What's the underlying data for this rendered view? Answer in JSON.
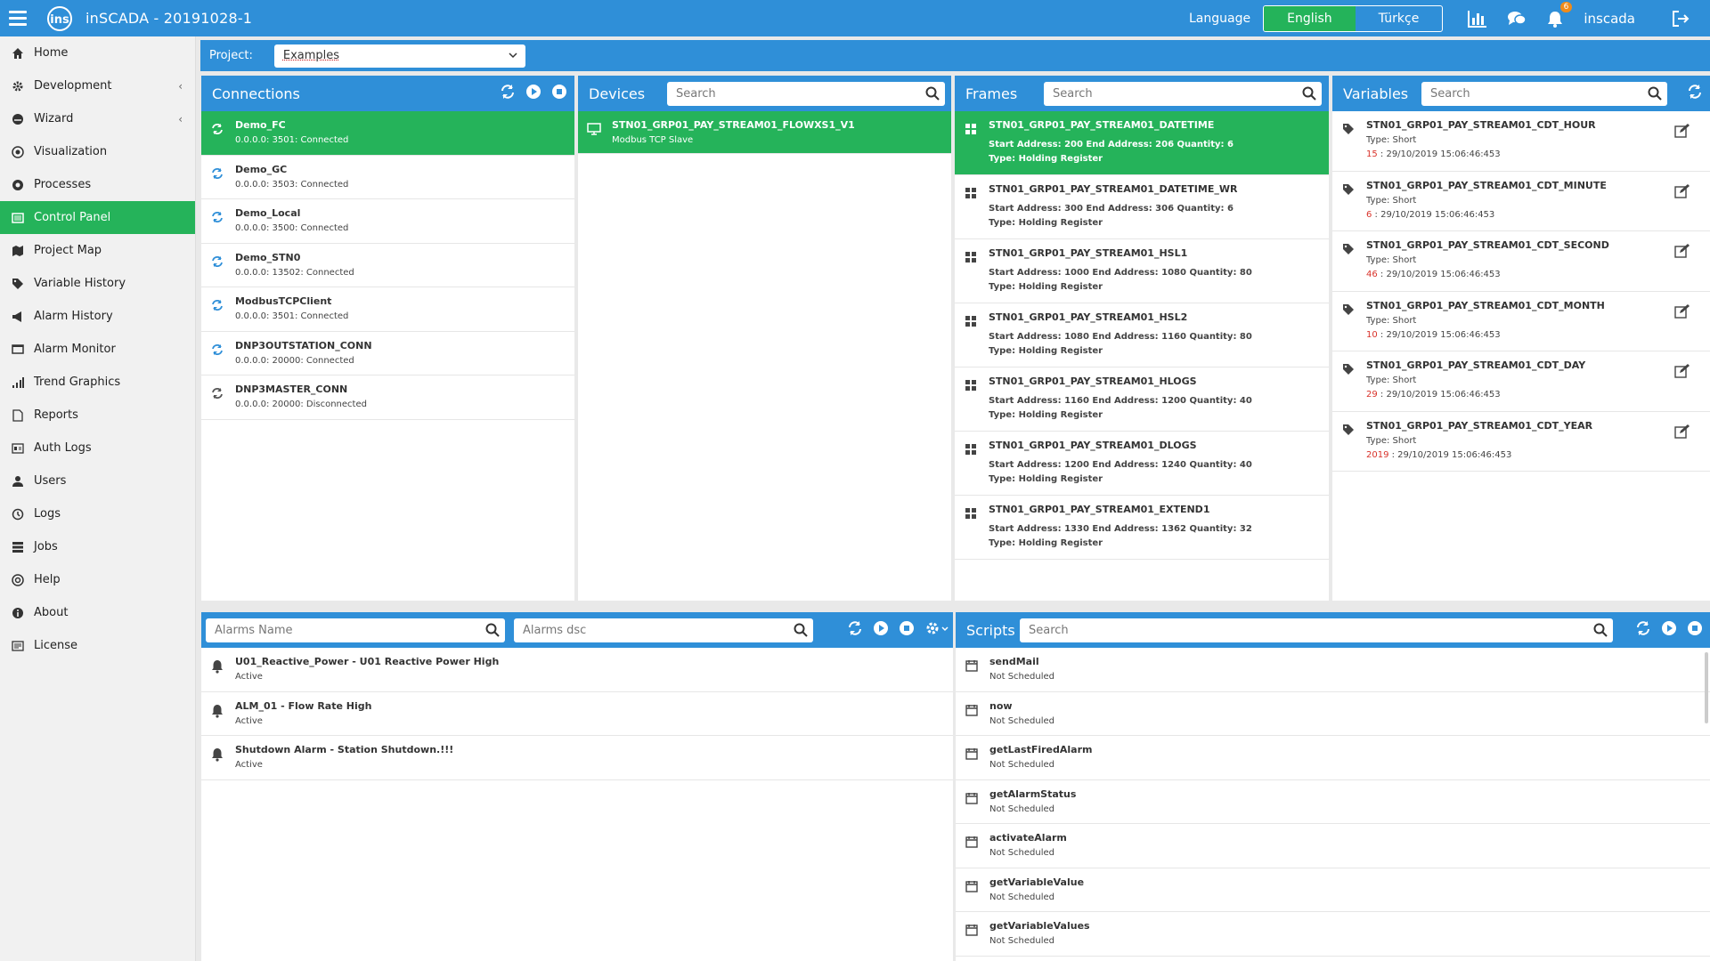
{
  "app": {
    "title": "inSCADA - 20191028-1"
  },
  "header": {
    "language_label": "Language",
    "languages": [
      {
        "label": "English",
        "active": true
      },
      {
        "label": "Türkçe",
        "active": false
      }
    ],
    "notification_count": "6",
    "username": "inscada"
  },
  "sidebar": {
    "items": [
      {
        "label": "Home",
        "icon": "home-icon",
        "active": false,
        "submenu": false
      },
      {
        "label": "Development",
        "icon": "gear-icon",
        "active": false,
        "submenu": true
      },
      {
        "label": "Wizard",
        "icon": "wizard-icon",
        "active": false,
        "submenu": true
      },
      {
        "label": "Visualization",
        "icon": "eye-icon",
        "active": false,
        "submenu": false
      },
      {
        "label": "Processes",
        "icon": "cog-circle-icon",
        "active": false,
        "submenu": false
      },
      {
        "label": "Control Panel",
        "icon": "control-panel-icon",
        "active": true,
        "submenu": false
      },
      {
        "label": "Project Map",
        "icon": "map-icon",
        "active": false,
        "submenu": false
      },
      {
        "label": "Variable History",
        "icon": "tag-icon",
        "active": false,
        "submenu": false
      },
      {
        "label": "Alarm History",
        "icon": "megaphone-icon",
        "active": false,
        "submenu": false
      },
      {
        "label": "Alarm Monitor",
        "icon": "monitor-icon",
        "active": false,
        "submenu": false
      },
      {
        "label": "Trend Graphics",
        "icon": "signal-icon",
        "active": false,
        "submenu": false
      },
      {
        "label": "Reports",
        "icon": "report-icon",
        "active": false,
        "submenu": false
      },
      {
        "label": "Auth Logs",
        "icon": "id-card-icon",
        "active": false,
        "submenu": false
      },
      {
        "label": "Users",
        "icon": "user-icon",
        "active": false,
        "submenu": false
      },
      {
        "label": "Logs",
        "icon": "history-icon",
        "active": false,
        "submenu": false
      },
      {
        "label": "Jobs",
        "icon": "server-icon",
        "active": false,
        "submenu": false
      },
      {
        "label": "Help",
        "icon": "help-icon",
        "active": false,
        "submenu": false
      },
      {
        "label": "About",
        "icon": "info-icon",
        "active": false,
        "submenu": false
      },
      {
        "label": "License",
        "icon": "license-icon",
        "active": false,
        "submenu": false
      }
    ]
  },
  "project": {
    "label": "Project:",
    "value": "Examples"
  },
  "connections": {
    "title": "Connections",
    "items": [
      {
        "name": "Demo_FC",
        "detail": "0.0.0.0: 3501: Connected",
        "selected": true
      },
      {
        "name": "Demo_GC",
        "detail": "0.0.0.0: 3503: Connected",
        "selected": false
      },
      {
        "name": "Demo_Local",
        "detail": "0.0.0.0: 3500: Connected",
        "selected": false
      },
      {
        "name": "Demo_STN0",
        "detail": "0.0.0.0: 13502: Connected",
        "selected": false
      },
      {
        "name": "ModbusTCPClient",
        "detail": "0.0.0.0: 3501: Connected",
        "selected": false
      },
      {
        "name": "DNP3OUTSTATION_CONN",
        "detail": "0.0.0.0: 20000: Connected",
        "selected": false
      },
      {
        "name": "DNP3MASTER_CONN",
        "detail": "0.0.0.0: 20000: Disconnected",
        "selected": false
      }
    ]
  },
  "devices": {
    "title": "Devices",
    "search_placeholder": "Search",
    "items": [
      {
        "name": "STN01_GRP01_PAY_STREAM01_FLOWXS1_V1",
        "detail": "Modbus TCP Slave",
        "selected": true
      }
    ]
  },
  "frames": {
    "title": "Frames",
    "search_placeholder": "Search",
    "items": [
      {
        "name": "STN01_GRP01_PAY_STREAM01_DATETIME",
        "address": "Start Address: 200 End Address: 206 Quantity: 6",
        "type": "Type: Holding Register",
        "selected": true
      },
      {
        "name": "STN01_GRP01_PAY_STREAM01_DATETIME_WR",
        "address": "Start Address: 300 End Address: 306 Quantity: 6",
        "type": "Type: Holding Register",
        "selected": false
      },
      {
        "name": "STN01_GRP01_PAY_STREAM01_HSL1",
        "address": "Start Address: 1000 End Address: 1080 Quantity: 80",
        "type": "Type: Holding Register",
        "selected": false
      },
      {
        "name": "STN01_GRP01_PAY_STREAM01_HSL2",
        "address": "Start Address: 1080 End Address: 1160 Quantity: 80",
        "type": "Type: Holding Register",
        "selected": false
      },
      {
        "name": "STN01_GRP01_PAY_STREAM01_HLOGS",
        "address": "Start Address: 1160 End Address: 1200 Quantity: 40",
        "type": "Type: Holding Register",
        "selected": false
      },
      {
        "name": "STN01_GRP01_PAY_STREAM01_DLOGS",
        "address": "Start Address: 1200 End Address: 1240 Quantity: 40",
        "type": "Type: Holding Register",
        "selected": false
      },
      {
        "name": "STN01_GRP01_PAY_STREAM01_EXTEND1",
        "address": "Start Address: 1330 End Address: 1362 Quantity: 32",
        "type": "Type: Holding Register",
        "selected": false
      }
    ]
  },
  "variables": {
    "title": "Variables",
    "search_placeholder": "Search",
    "items": [
      {
        "name": "STN01_GRP01_PAY_STREAM01_CDT_HOUR",
        "type": "Type: Short",
        "value": "15",
        "time": " : 29/10/2019 15:06:46:453"
      },
      {
        "name": "STN01_GRP01_PAY_STREAM01_CDT_MINUTE",
        "type": "Type: Short",
        "value": "6",
        "time": " : 29/10/2019 15:06:46:453"
      },
      {
        "name": "STN01_GRP01_PAY_STREAM01_CDT_SECOND",
        "type": "Type: Short",
        "value": "46",
        "time": " : 29/10/2019 15:06:46:453"
      },
      {
        "name": "STN01_GRP01_PAY_STREAM01_CDT_MONTH",
        "type": "Type: Short",
        "value": "10",
        "time": " : 29/10/2019 15:06:46:453"
      },
      {
        "name": "STN01_GRP01_PAY_STREAM01_CDT_DAY",
        "type": "Type: Short",
        "value": "29",
        "time": " : 29/10/2019 15:06:46:453"
      },
      {
        "name": "STN01_GRP01_PAY_STREAM01_CDT_YEAR",
        "type": "Type: Short",
        "value": "2019",
        "time": " : 29/10/2019 15:06:46:453"
      }
    ]
  },
  "alarms": {
    "name_placeholder": "Alarms Name",
    "dsc_placeholder": "Alarms dsc",
    "items": [
      {
        "name": "U01_Reactive_Power - U01 Reactive Power High",
        "status": "Active"
      },
      {
        "name": "ALM_01 - Flow Rate High",
        "status": "Active"
      },
      {
        "name": "Shutdown Alarm - Station Shutdown.!!!",
        "status": "Active"
      }
    ]
  },
  "scripts": {
    "title": "Scripts",
    "search_placeholder": "Search",
    "items": [
      {
        "name": "sendMail",
        "status": "Not Scheduled"
      },
      {
        "name": "now",
        "status": "Not Scheduled"
      },
      {
        "name": "getLastFiredAlarm",
        "status": "Not Scheduled"
      },
      {
        "name": "getAlarmStatus",
        "status": "Not Scheduled"
      },
      {
        "name": "activateAlarm",
        "status": "Not Scheduled"
      },
      {
        "name": "getVariableValue",
        "status": "Not Scheduled"
      },
      {
        "name": "getVariableValues",
        "status": "Not Scheduled"
      }
    ]
  },
  "colors": {
    "primary": "#2f8fd8",
    "selected": "#25b35a",
    "value_red": "#d9332b",
    "badge": "#f08b1a"
  }
}
